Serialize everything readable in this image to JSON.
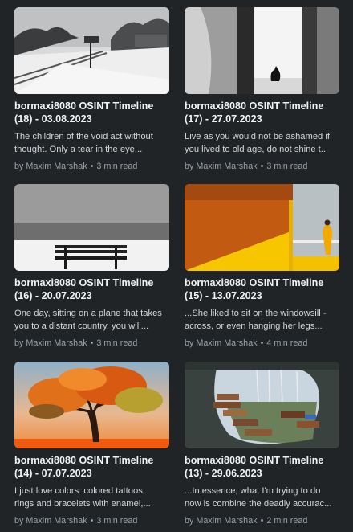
{
  "posts": [
    {
      "title_line1": "bormaxi8080 OSINT Timeline",
      "title_line2": "(18) - 03.08.2023",
      "excerpt_line1": "The children of the void act without",
      "excerpt_line2": "thought. Only a tear in the eye...",
      "author": "by Maxim Marshak",
      "separator": "•",
      "read_time": "3 min read",
      "image_icon": "snowy-railway-photo"
    },
    {
      "title_line1": "bormaxi8080 OSINT Timeline",
      "title_line2": "(17) - 27.07.2023",
      "excerpt_line1": "Live as you would not be ashamed if",
      "excerpt_line2": "you lived to old age, do not shine t...",
      "author": "by Maxim Marshak",
      "separator": "•",
      "read_time": "3 min read",
      "image_icon": "cat-in-doorway-photo"
    },
    {
      "title_line1": "bormaxi8080 OSINT Timeline",
      "title_line2": "(16) - 20.07.2023",
      "excerpt_line1": "One day, sitting on a plane that takes",
      "excerpt_line2": "you to a distant country, you will...",
      "author": "by Maxim Marshak",
      "separator": "•",
      "read_time": "3 min read",
      "image_icon": "bench-by-sea-photo"
    },
    {
      "title_line1": "bormaxi8080 OSINT Timeline",
      "title_line2": "(15) - 13.07.2023",
      "excerpt_line1": "...She liked to sit on the windowsill -",
      "excerpt_line2": "across, or even hanging her legs...",
      "author": "by Maxim Marshak",
      "separator": "•",
      "read_time": "4 min read",
      "image_icon": "yellow-balcony-photo"
    },
    {
      "title_line1": "bormaxi8080 OSINT Timeline",
      "title_line2": "(14) - 07.07.2023",
      "excerpt_line1": "I just love colors: colored tattoos,",
      "excerpt_line2": "rings and bracelets with enamel,...",
      "author": "by Maxim Marshak",
      "separator": "•",
      "read_time": "3 min read",
      "image_icon": "orange-tree-photo"
    },
    {
      "title_line1": "bormaxi8080 OSINT Timeline",
      "title_line2": "(13) - 29.06.2023",
      "excerpt_line1": "...In essence, what I'm trying to do",
      "excerpt_line2": "now is combine the deadly accurac...",
      "author": "by Maxim Marshak",
      "separator": "•",
      "read_time": "2 min read",
      "image_icon": "broken-brick-wall-photo"
    }
  ]
}
